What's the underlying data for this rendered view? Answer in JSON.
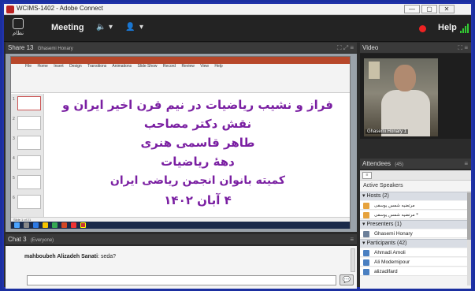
{
  "window": {
    "title": "WCIMS-1402 - Adobe Connect",
    "min_glyph": "—",
    "max_glyph": "▢",
    "close_glyph": "✕"
  },
  "menubar": {
    "logo_caption": "نظام",
    "meeting_label": "Meeting",
    "speaker_glyph": "🔈",
    "dropdown_glyph": "▾",
    "person_glyph": "👤",
    "help_label": "Help",
    "recording_color": "#e22222",
    "signal_color": "#33cc33"
  },
  "share_pod": {
    "title": "Share 13",
    "presenter": "Ghasemi Honary",
    "icons": "⛶ ⤢ ≡",
    "powerpoint": {
      "tabs": [
        "File",
        "Home",
        "Insert",
        "Design",
        "Transitions",
        "Animations",
        "Slide Show",
        "Record",
        "Review",
        "View",
        "Help"
      ],
      "title_text": "Search (Alt+Q)",
      "slide_lines": [
        "فراز و نشیب ریاضیات در نیم قرن اخیر ایران و",
        "نقش دکتر مصاحب",
        "طاهر قاسمی هنری",
        "دههٔ ریاضیات",
        "کمیته بانوان انجمن ریاضی ایران",
        "۴ آبان ۱۴۰۲"
      ],
      "thumbnail_numbers": [
        "1",
        "2",
        "3",
        "4",
        "5",
        "6"
      ],
      "status_text": "Slide 1 of 21"
    }
  },
  "video_pod": {
    "title": "Video",
    "icons": "⛶ ≡",
    "participant_name": "Ghasemi Honary 1"
  },
  "attendees_pod": {
    "title": "Attendees",
    "count": "(45)",
    "icons": "≡",
    "active_speakers_label": "Active Speakers",
    "groups": {
      "hosts": {
        "label": "Hosts (2)",
        "members": [
          "مرتضیه شمس یوسفی",
          "مرتضیه شمس یوسفی *"
        ]
      },
      "presenters": {
        "label": "Presenters (1)",
        "members": [
          "Ghasemi Honary"
        ]
      },
      "participants": {
        "label": "Participants (42)",
        "members": [
          "Ahmadi Amoli",
          "Ali Modemipour",
          "alizadifard"
        ]
      }
    }
  },
  "chat_pod": {
    "title": "Chat 3",
    "scope": "(Everyone)",
    "icons": "≡",
    "messages": [
      {
        "sender": "mahboubeh Alizadeh Sanati",
        "text": "seda?"
      }
    ],
    "input_value": "",
    "send_glyph": "💬"
  }
}
